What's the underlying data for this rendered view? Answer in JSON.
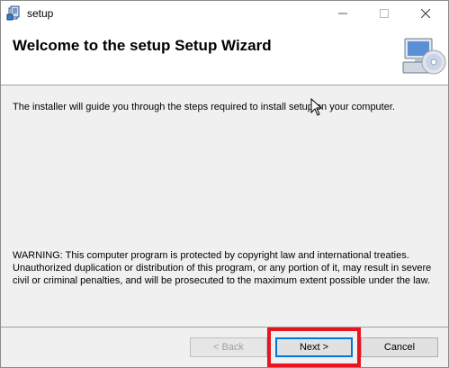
{
  "window": {
    "title": "setup",
    "icons": {
      "app": "setup-package-icon",
      "minimize": "minimize-icon",
      "maximize": "maximize-icon",
      "close": "close-icon"
    }
  },
  "header": {
    "title": "Welcome to the setup Setup Wizard",
    "icon": "computer-disc-icon"
  },
  "content": {
    "intro": "The installer will guide you through the steps required to install setup on your computer.",
    "warning": "WARNING: This computer program is protected by copyright law and international treaties. Unauthorized duplication or distribution of this program, or any portion of it, may result in severe civil or criminal penalties, and will be prosecuted to the maximum extent possible under the law."
  },
  "buttons": {
    "back": "< Back",
    "next": "Next >",
    "cancel": "Cancel"
  },
  "colors": {
    "highlight": "#e8141e",
    "focus": "#0078d7"
  }
}
